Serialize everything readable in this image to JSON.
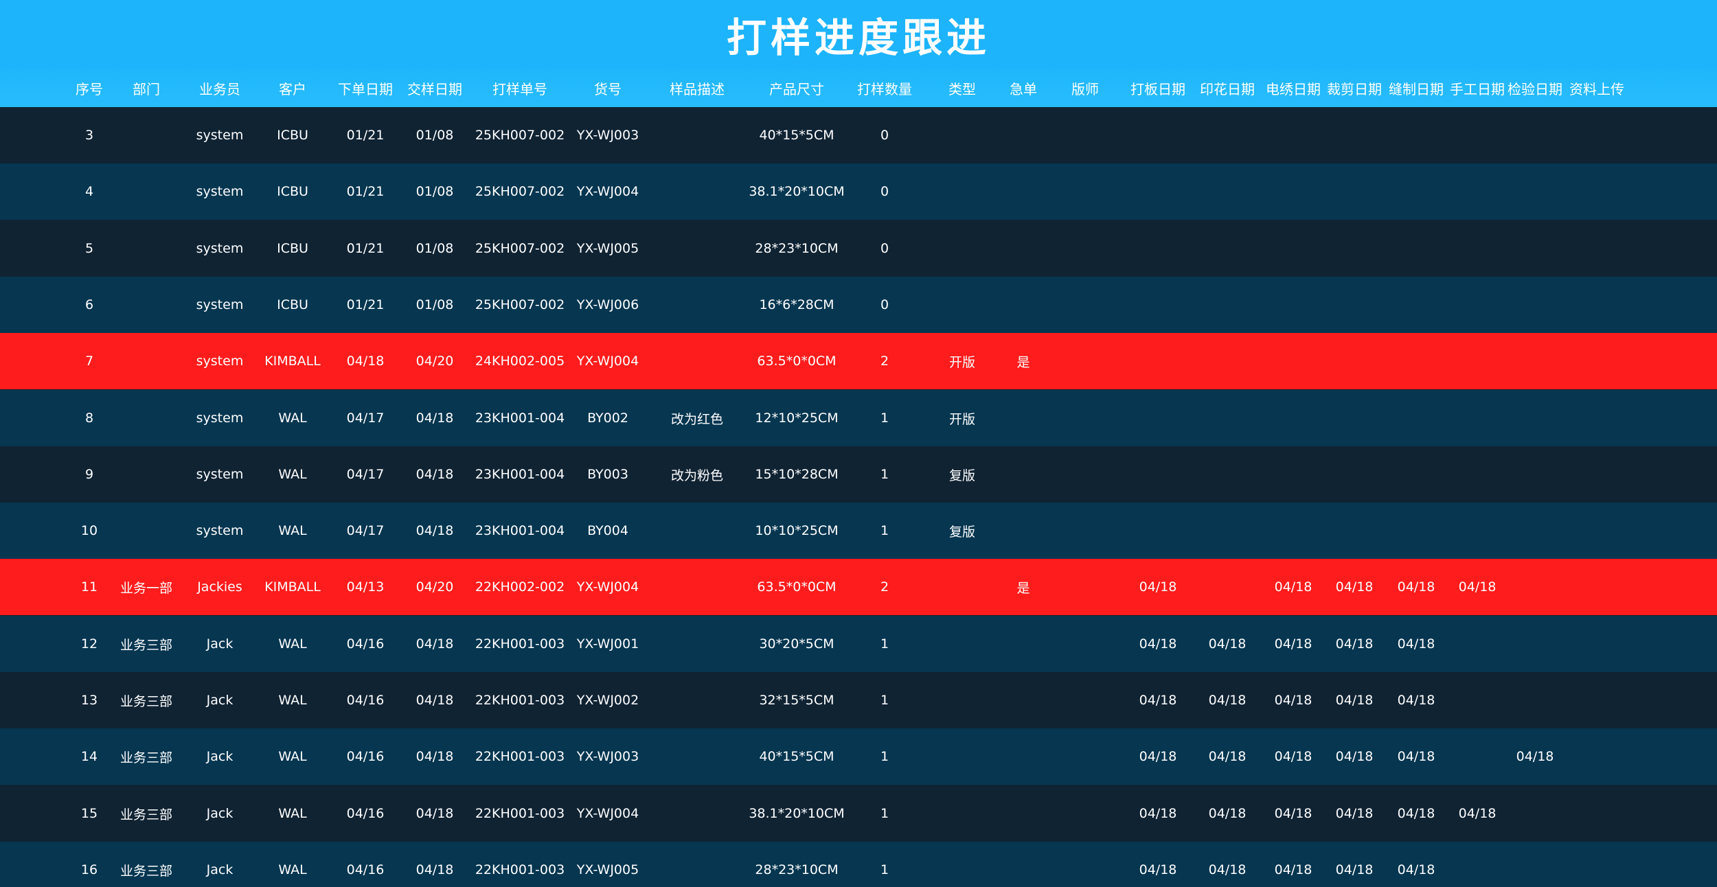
{
  "title": "打样进度跟进",
  "colors": {
    "header": "#1db4fb",
    "row_dark": "#102333",
    "row_teal": "#063650",
    "row_urgent": "#ff1c1c"
  },
  "columns": [
    "序号",
    "部门",
    "业务员",
    "客户",
    "下单日期",
    "交样日期",
    "打样单号",
    "货号",
    "样品描述",
    "产品尺寸",
    "打样数量",
    "类型",
    "急单",
    "版师",
    "打板日期",
    "印花日期",
    "电绣日期",
    "裁剪日期",
    "缝制日期",
    "手工日期",
    "检验日期",
    "资料上传"
  ],
  "rows": [
    {
      "style": "dark",
      "cells": [
        "3",
        "",
        "system",
        "ICBU",
        "01/21",
        "01/08",
        "25KH007-002",
        "YX-WJ003",
        "",
        "40*15*5CM",
        "0",
        "",
        "",
        "",
        "",
        "",
        "",
        "",
        "",
        "",
        "",
        ""
      ]
    },
    {
      "style": "teal",
      "cells": [
        "4",
        "",
        "system",
        "ICBU",
        "01/21",
        "01/08",
        "25KH007-002",
        "YX-WJ004",
        "",
        "38.1*20*10CM",
        "0",
        "",
        "",
        "",
        "",
        "",
        "",
        "",
        "",
        "",
        "",
        ""
      ]
    },
    {
      "style": "dark",
      "cells": [
        "5",
        "",
        "system",
        "ICBU",
        "01/21",
        "01/08",
        "25KH007-002",
        "YX-WJ005",
        "",
        "28*23*10CM",
        "0",
        "",
        "",
        "",
        "",
        "",
        "",
        "",
        "",
        "",
        "",
        ""
      ]
    },
    {
      "style": "teal",
      "cells": [
        "6",
        "",
        "system",
        "ICBU",
        "01/21",
        "01/08",
        "25KH007-002",
        "YX-WJ006",
        "",
        "16*6*28CM",
        "0",
        "",
        "",
        "",
        "",
        "",
        "",
        "",
        "",
        "",
        "",
        ""
      ]
    },
    {
      "style": "red",
      "cells": [
        "7",
        "",
        "system",
        "KIMBALL",
        "04/18",
        "04/20",
        "24KH002-005",
        "YX-WJ004",
        "",
        "63.5*0*0CM",
        "2",
        "开版",
        "是",
        "",
        "",
        "",
        "",
        "",
        "",
        "",
        "",
        ""
      ]
    },
    {
      "style": "teal",
      "cells": [
        "8",
        "",
        "system",
        "WAL",
        "04/17",
        "04/18",
        "23KH001-004",
        "BY002",
        "改为红色",
        "12*10*25CM",
        "1",
        "开版",
        "",
        "",
        "",
        "",
        "",
        "",
        "",
        "",
        "",
        ""
      ]
    },
    {
      "style": "dark",
      "cells": [
        "9",
        "",
        "system",
        "WAL",
        "04/17",
        "04/18",
        "23KH001-004",
        "BY003",
        "改为粉色",
        "15*10*28CM",
        "1",
        "复版",
        "",
        "",
        "",
        "",
        "",
        "",
        "",
        "",
        "",
        ""
      ]
    },
    {
      "style": "teal",
      "cells": [
        "10",
        "",
        "system",
        "WAL",
        "04/17",
        "04/18",
        "23KH001-004",
        "BY004",
        "",
        "10*10*25CM",
        "1",
        "复版",
        "",
        "",
        "",
        "",
        "",
        "",
        "",
        "",
        "",
        ""
      ]
    },
    {
      "style": "red",
      "cells": [
        "11",
        "业务一部",
        "Jackies",
        "KIMBALL",
        "04/13",
        "04/20",
        "22KH002-002",
        "YX-WJ004",
        "",
        "63.5*0*0CM",
        "2",
        "",
        "是",
        "",
        "04/18",
        "",
        "04/18",
        "04/18",
        "04/18",
        "04/18",
        "",
        ""
      ]
    },
    {
      "style": "teal",
      "cells": [
        "12",
        "业务三部",
        "Jack",
        "WAL",
        "04/16",
        "04/18",
        "22KH001-003",
        "YX-WJ001",
        "",
        "30*20*5CM",
        "1",
        "",
        "",
        "",
        "04/18",
        "04/18",
        "04/18",
        "04/18",
        "04/18",
        "",
        "",
        ""
      ]
    },
    {
      "style": "dark",
      "cells": [
        "13",
        "业务三部",
        "Jack",
        "WAL",
        "04/16",
        "04/18",
        "22KH001-003",
        "YX-WJ002",
        "",
        "32*15*5CM",
        "1",
        "",
        "",
        "",
        "04/18",
        "04/18",
        "04/18",
        "04/18",
        "04/18",
        "",
        "",
        ""
      ]
    },
    {
      "style": "teal",
      "cells": [
        "14",
        "业务三部",
        "Jack",
        "WAL",
        "04/16",
        "04/18",
        "22KH001-003",
        "YX-WJ003",
        "",
        "40*15*5CM",
        "1",
        "",
        "",
        "",
        "04/18",
        "04/18",
        "04/18",
        "04/18",
        "04/18",
        "",
        "04/18",
        ""
      ]
    },
    {
      "style": "dark",
      "cells": [
        "15",
        "业务三部",
        "Jack",
        "WAL",
        "04/16",
        "04/18",
        "22KH001-003",
        "YX-WJ004",
        "",
        "38.1*20*10CM",
        "1",
        "",
        "",
        "",
        "04/18",
        "04/18",
        "04/18",
        "04/18",
        "04/18",
        "04/18",
        "",
        ""
      ]
    },
    {
      "style": "teal",
      "cells": [
        "16",
        "业务三部",
        "Jack",
        "WAL",
        "04/16",
        "04/18",
        "22KH001-003",
        "YX-WJ005",
        "",
        "28*23*10CM",
        "1",
        "",
        "",
        "",
        "04/18",
        "04/18",
        "04/18",
        "04/18",
        "04/18",
        "",
        "",
        ""
      ]
    }
  ]
}
